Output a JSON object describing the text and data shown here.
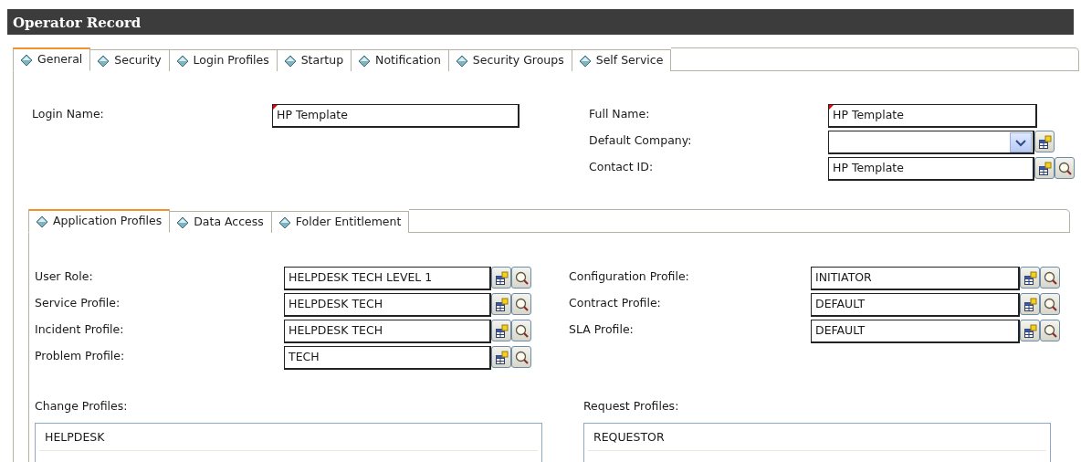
{
  "window": {
    "title": "Operator Record"
  },
  "tabs": [
    {
      "label": "General",
      "selected": true
    },
    {
      "label": "Security",
      "selected": false
    },
    {
      "label": "Login Profiles",
      "selected": false
    },
    {
      "label": "Startup",
      "selected": false
    },
    {
      "label": "Notification",
      "selected": false
    },
    {
      "label": "Security Groups",
      "selected": false
    },
    {
      "label": "Self Service",
      "selected": false
    }
  ],
  "general": {
    "left_fields": [
      {
        "label": "Login Name:",
        "value": "HP Template",
        "kind": "text",
        "required": true
      }
    ],
    "right_fields": [
      {
        "label": "Full Name:",
        "value": "HP Template",
        "kind": "text",
        "required": true
      },
      {
        "label": "Default Company:",
        "kind": "combo",
        "required": false
      },
      {
        "label": "Contact ID:",
        "value": "HP Template",
        "kind": "lookup",
        "required": false
      }
    ]
  },
  "subtabs": [
    {
      "label": "Application Profiles",
      "selected": true
    },
    {
      "label": "Data Access",
      "selected": false
    },
    {
      "label": "Folder Entitlement",
      "selected": false
    }
  ],
  "application_profiles": {
    "left_fields": [
      {
        "label": "User Role:",
        "value": "HELPDESK TECH LEVEL 1",
        "kind": "lookup",
        "required": false
      },
      {
        "label": "Service Profile:",
        "value": "HELPDESK TECH",
        "kind": "lookup",
        "required": false
      },
      {
        "label": "Incident Profile:",
        "value": "HELPDESK TECH",
        "kind": "lookup",
        "required": false
      },
      {
        "label": "Problem Profile:",
        "value": "TECH",
        "kind": "lookup",
        "required": false
      }
    ],
    "right_fields": [
      {
        "label": "Configuration Profile:",
        "value": "INITIATOR",
        "kind": "lookup",
        "required": false
      },
      {
        "label": "Contract Profile:",
        "value": "DEFAULT",
        "kind": "lookup",
        "required": false
      },
      {
        "label": "SLA Profile:",
        "value": "DEFAULT",
        "kind": "lookup",
        "required": false
      }
    ],
    "lists": [
      {
        "label": "Change Profiles:",
        "items": [
          "HELPDESK"
        ]
      },
      {
        "label": "Request Profiles:",
        "items": [
          "REQUESTOR"
        ]
      }
    ]
  }
}
